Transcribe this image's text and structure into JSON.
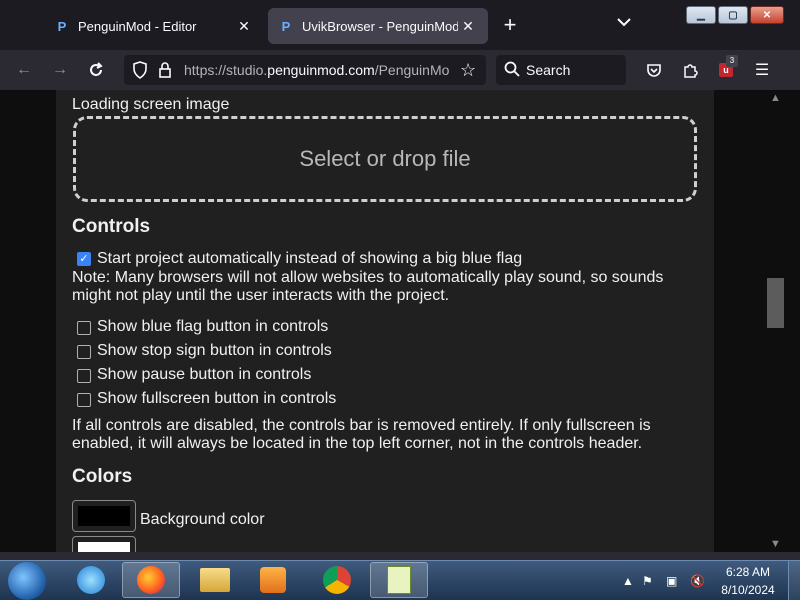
{
  "tabs": [
    {
      "title": "PenguinMod - Editor",
      "active": false
    },
    {
      "title": "UvikBrowser - PenguinMod Pa",
      "active": true
    }
  ],
  "url": {
    "prefix": "https://studio.",
    "host": "penguinmod.com",
    "path": "/PenguinMo"
  },
  "search": {
    "placeholder": "Search"
  },
  "extension_badge": "3",
  "content": {
    "loading_label": "Loading screen image",
    "dropzone_text": "Select or drop file",
    "controls_heading": "Controls",
    "autostart_label": "Start project automatically instead of showing a big blue flag",
    "autostart_checked": true,
    "note_line1": "Note: Many browsers will not allow websites to automatically play sound, so sounds",
    "note_line2": "might not play until the user interacts with the project.",
    "options": [
      {
        "label": "Show blue flag button in controls",
        "checked": false
      },
      {
        "label": "Show stop sign button in controls",
        "checked": false
      },
      {
        "label": "Show pause button in controls",
        "checked": false
      },
      {
        "label": "Show fullscreen button in controls",
        "checked": false
      }
    ],
    "info_line1": "If all controls are disabled, the controls bar is removed entirely. If only fullscreen is",
    "info_line2": "enabled, it will always be located in the top left corner, not in the controls header.",
    "colors_heading": "Colors",
    "background_color_label": "Background color",
    "background_color": "#000000",
    "foreground_color": "#ffffff"
  },
  "taskbar": {
    "time": "6:28 AM",
    "date": "8/10/2024"
  },
  "colors": {
    "accent_checkbox": "#3b82f6",
    "panel_bg": "#202020",
    "page_bg": "#0e0e0e"
  }
}
